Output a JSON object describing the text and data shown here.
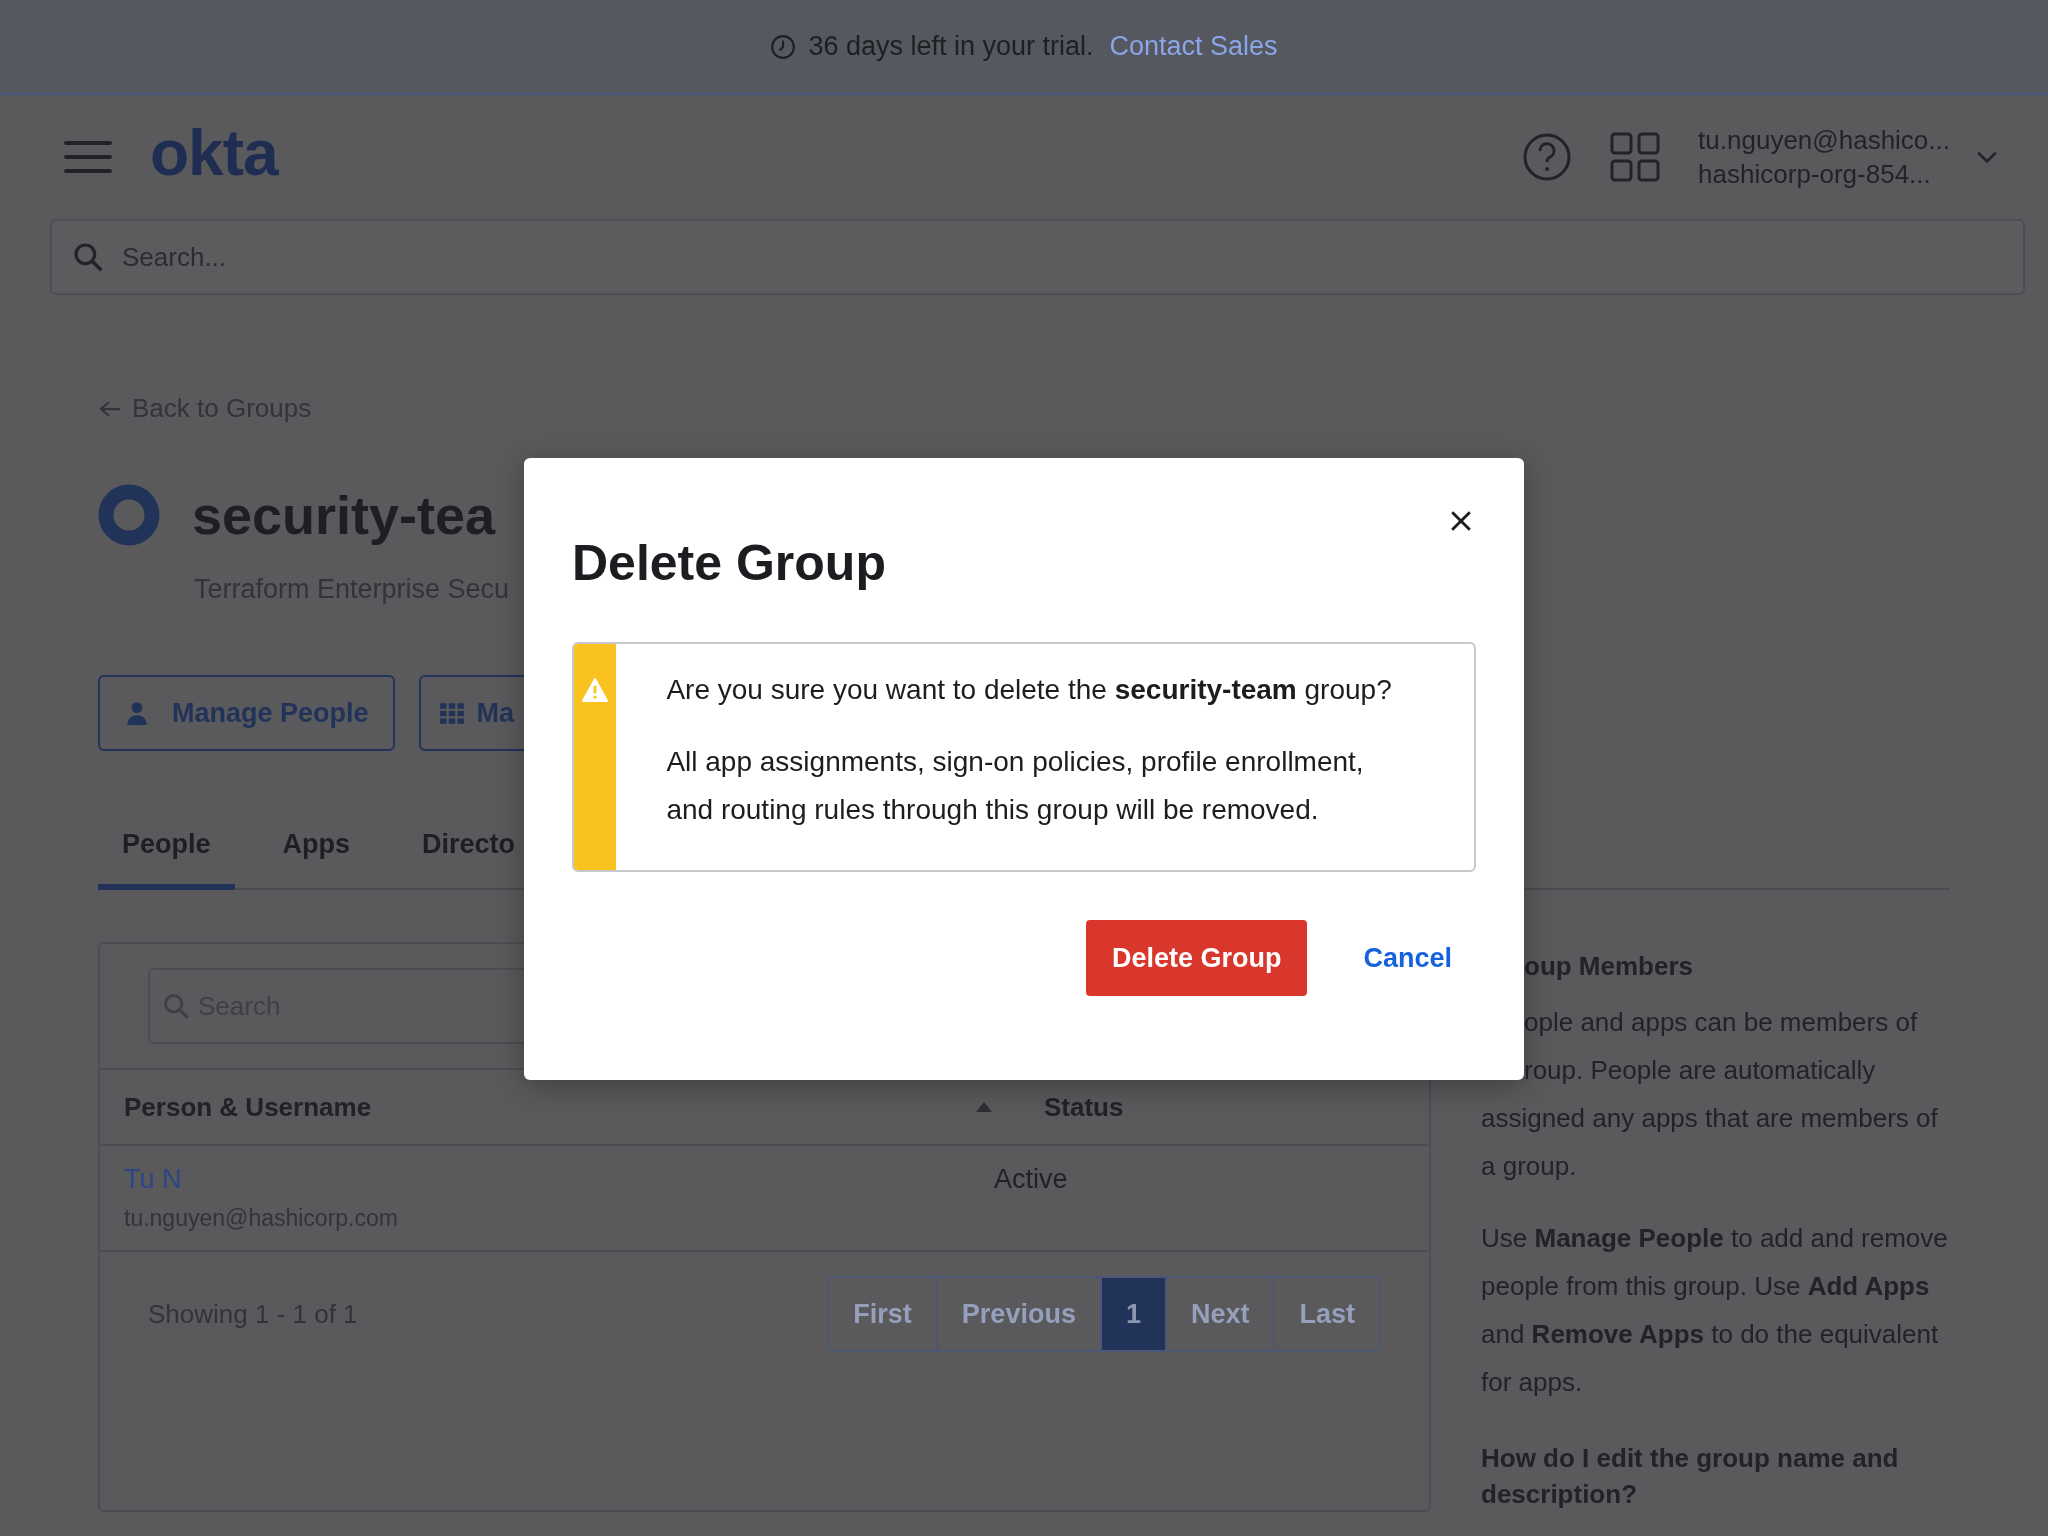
{
  "trial_banner": {
    "text": "36 days left in your trial.",
    "link": "Contact Sales"
  },
  "header": {
    "logo": "okta",
    "user": {
      "email": "tu.nguyen@hashico...",
      "org": "hashicorp-org-854..."
    }
  },
  "search": {
    "placeholder": "Search..."
  },
  "back_link": "Back to Groups",
  "group": {
    "name": "security-tea",
    "description": "Terraform Enterprise Secu"
  },
  "action_buttons": [
    {
      "label": "Manage People",
      "kind": "person"
    },
    {
      "label": "Ma",
      "kind": "grid"
    }
  ],
  "tabs": [
    {
      "label": "People",
      "selected": true
    },
    {
      "label": "Apps",
      "selected": false
    },
    {
      "label": "Directo",
      "selected": false
    }
  ],
  "members": {
    "search": {
      "placeholder": "Search"
    },
    "columns": [
      "Person & Username",
      "Status"
    ],
    "rows": [
      {
        "name": "Tu N",
        "username": "tu.nguyen@hashicorp.com",
        "status": "Active"
      }
    ],
    "showing": "Showing 1 - 1 of 1",
    "pagination": [
      {
        "label": "First",
        "selected": false
      },
      {
        "label": "Previous",
        "selected": false
      },
      {
        "label": "1",
        "selected": true
      },
      {
        "label": "Next",
        "selected": false
      },
      {
        "label": "Last",
        "selected": false
      }
    ]
  },
  "help": {
    "heading": "oup Members",
    "fragments": [
      "ople and apps can be members of",
      "roup. People are automatically"
    ],
    "continuation": "assigned any apps that are members of a group.",
    "paragraph": "Use **Manage People** to add and remove people from this group. Use **Add Apps** and **Remove Apps** to do the equivalent for apps.",
    "question": "How do I edit the group name and description?"
  },
  "dialog": {
    "title": "Delete Group",
    "message": "Are you sure you want to delete the **security-team** group?",
    "detail": "All app assignments, sign-on policies, profile enrollment, and routing rules through this group will be removed.",
    "buttons": [
      {
        "label": "Delete Group",
        "kind": "danger"
      },
      {
        "label": "Cancel",
        "kind": "link"
      }
    ]
  }
}
